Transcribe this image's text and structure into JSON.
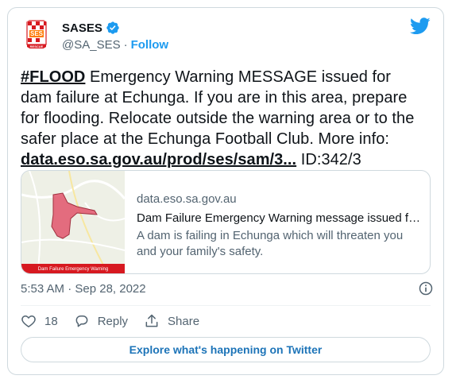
{
  "header": {
    "display_name": "SASES",
    "handle": "@SA_SES",
    "separator": "·",
    "follow_label": "Follow",
    "avatar_text": "SES",
    "avatar_subtext": "RESCUE"
  },
  "tweet": {
    "hashtag": "#FLOOD",
    "body": " Emergency Warning MESSAGE issued for dam failure at Echunga. If you are in this area, prepare for flooding. Relocate outside the warning area or to the safer place at the Echunga Football Club. More info: ",
    "link": "data.eso.sa.gov.au/prod/ses/sam/3...",
    "suffix": " ID:342/3"
  },
  "link_card": {
    "domain": "data.eso.sa.gov.au",
    "title": "Dam Failure Emergency Warning message issued for...",
    "description": "A dam is failing in Echunga which will threaten you and your family's safety.",
    "thumb_banner": "Dam Failure Emergency Warning"
  },
  "meta": {
    "timestamp": "5:53 AM · Sep 28, 2022"
  },
  "actions": {
    "like_count": "18",
    "reply_label": "Reply",
    "share_label": "Share"
  },
  "explore_label": "Explore what's happening on Twitter",
  "colors": {
    "accent": "#1d9bf0",
    "text": "#0f1419",
    "muted": "#536471",
    "border": "#cfd9de",
    "warning_red": "#d71920"
  }
}
